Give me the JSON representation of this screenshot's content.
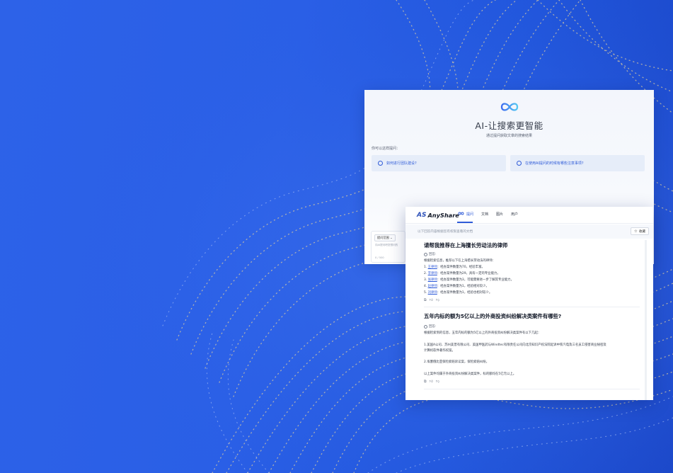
{
  "back_window": {
    "title": "AI-让搜索更智能",
    "subtitle": "通过提问获取文章的搜索结果",
    "prompt_label": "你可以这样提问：",
    "suggestions": [
      {
        "label": "如何进行团队建设?"
      },
      {
        "label": "在使用AI提问的时候有哪些注意事项?"
      }
    ],
    "input": {
      "chip": "提问范围 ⌄",
      "placeholder": "向AI提问吧您想问的",
      "counter": "0 / 500"
    }
  },
  "front_window": {
    "brand_mark": "AS",
    "brand_name": "AnyShare",
    "tabs": [
      {
        "label": "提问"
      },
      {
        "label": "文档"
      },
      {
        "label": "图片"
      },
      {
        "label": "用户"
      }
    ],
    "hint": "以下回答内容根据您有权限查看的文档",
    "collect_label": "收藏",
    "answer_label": "回答:",
    "qa": [
      {
        "question": "请帮我推荐在上海擅长劳动法的律师",
        "intro": "根据检索信息，推荐以下在上海擅长劳动法的律师：",
        "items": [
          {
            "num": "1.",
            "name": "王律师",
            "text": "：经办案件数量为70，经验丰富。"
          },
          {
            "num": "2.",
            "name": "李律师",
            "text": "：经办案件数量为29，具有一定的专业能力。"
          },
          {
            "num": "3.",
            "name": "张律师",
            "text": "：经办案件数量为3，可能需要进一步了解其专业能力。"
          },
          {
            "num": "4.",
            "name": "赵律师",
            "text": "：经办案件数量为1，经验相对较少。"
          },
          {
            "num": "5.",
            "name": "刘律师",
            "text": "：经办案件数量为1，经验也相对较少。"
          }
        ]
      },
      {
        "question": "五年内标的额为5亿以上的外商投资纠纷解决类案件有哪些?",
        "intro": "根据检索到的信息，五年内标的额为5亿以上的外商投资纠纷解决类案件有以下几起：",
        "paragraphs": [
          "1.美国A公司、苏州美普有限公司、美国甲医药与Windtec有限责任公司向北京知识产权法院起诉中铁汽电及三名员工侵害商业秘密及",
          "计算机软件著作权案。",
          "2.埃塞俄比亚保险索赔诉讼案，保险索赔纠纷。",
          "以上案件均属于外商投资纠纷解决类案件，标的额均在5亿元以上。"
        ]
      }
    ]
  }
}
